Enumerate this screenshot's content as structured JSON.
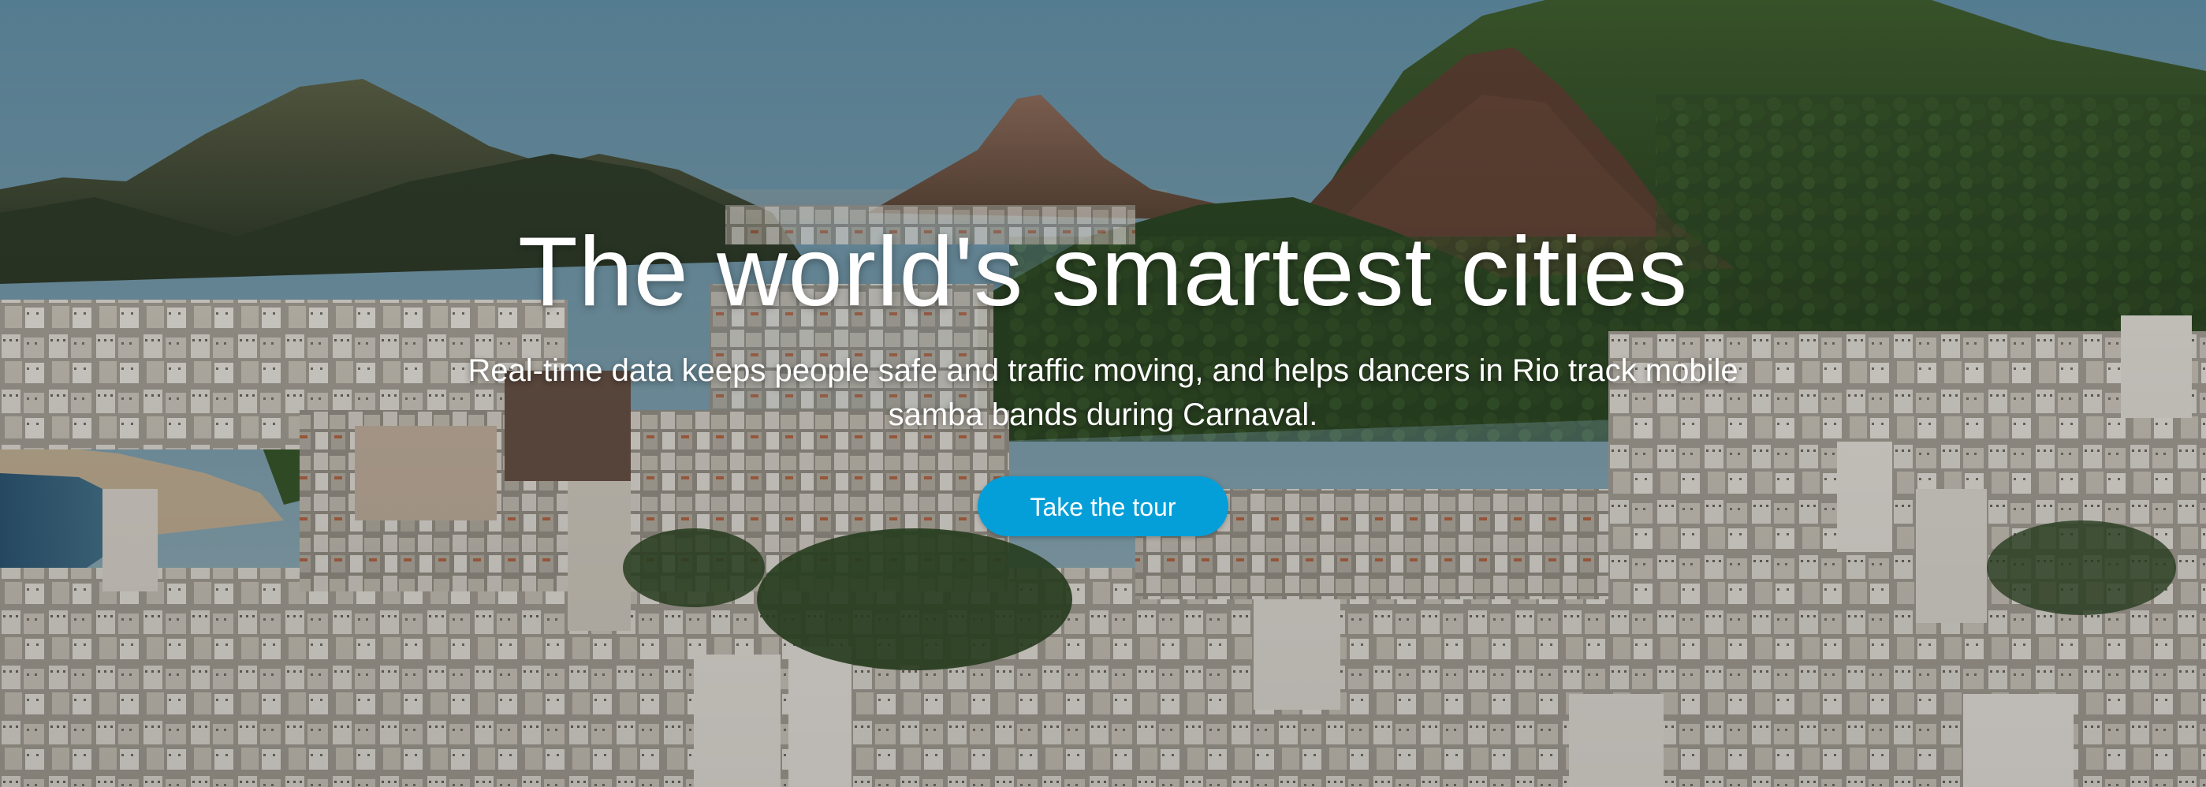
{
  "hero": {
    "headline": "The world's smartest cities",
    "subhead": "Real-time data keeps people safe and traffic moving, and helps dancers in Rio track mobile samba bands during Carnaval.",
    "cta_label": "Take the tour",
    "background_image": "aerial-city-mountains-photo"
  },
  "colors": {
    "cta_background": "#049fd9",
    "text": "#ffffff"
  }
}
